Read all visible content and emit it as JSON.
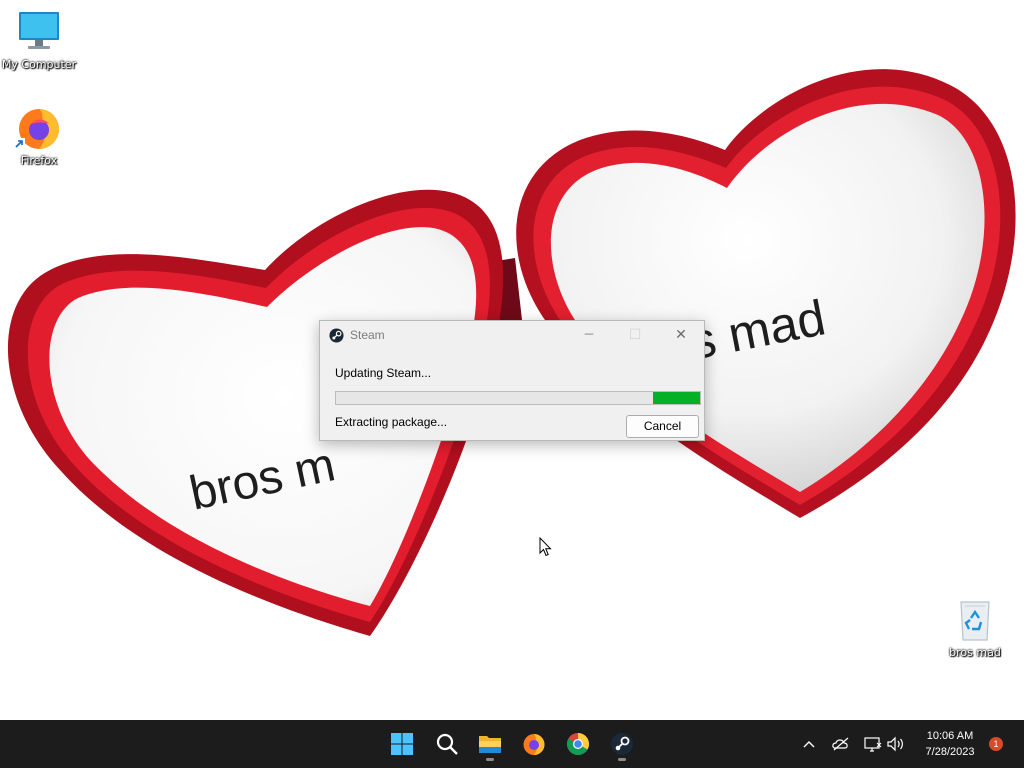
{
  "desktop": {
    "wallpaper": {
      "text_left": "bros m",
      "text_right": "bros mad",
      "heart_color": "#d2142c"
    },
    "icons": [
      {
        "name": "my-computer",
        "label": "My Computer"
      },
      {
        "name": "firefox",
        "label": "Firefox"
      },
      {
        "name": "recycle-bin",
        "label": "bros mad"
      }
    ]
  },
  "dialog": {
    "title": "Steam",
    "status_main": "Updating Steam...",
    "status_sub": "Extracting package...",
    "cancel_label": "Cancel",
    "progress_fraction": 0.13,
    "progress_color": "#06b025",
    "window_buttons": {
      "minimize": "─",
      "maximize": "☐",
      "close": "✕"
    }
  },
  "taskbar": {
    "apps": [
      "start-icon",
      "search-icon",
      "file-explorer-icon",
      "firefox-icon",
      "chrome-icon",
      "steam-icon"
    ],
    "tray": [
      "chevron-up-icon",
      "onedrive-icon",
      "network-icon",
      "volume-icon"
    ],
    "clock": {
      "time": "10:06 AM",
      "date": "7/28/2023"
    },
    "notification_count": "1"
  }
}
